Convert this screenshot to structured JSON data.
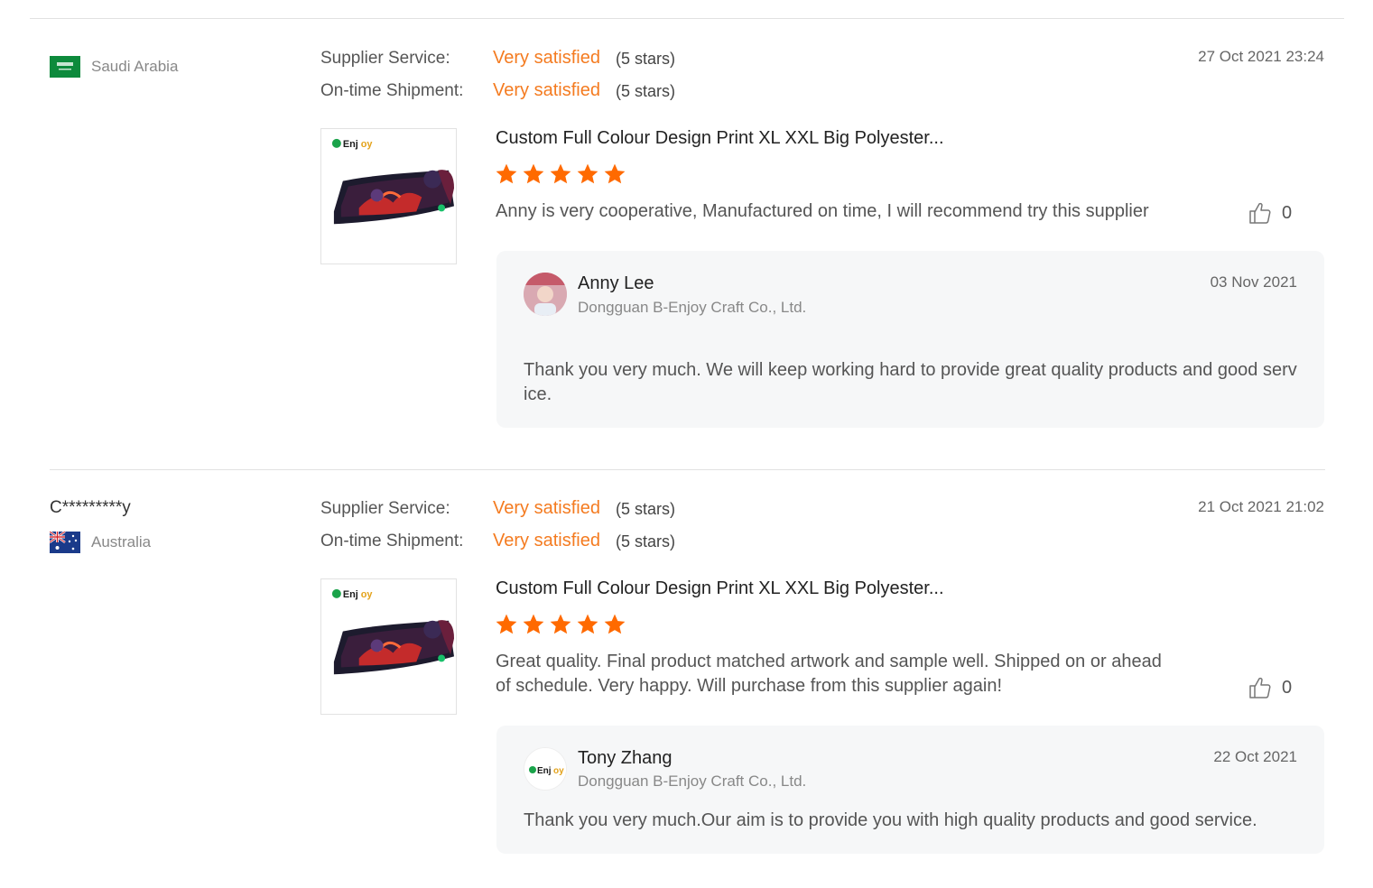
{
  "reviews": [
    {
      "buyer": "",
      "country": "Saudi Arabia",
      "flag_icon": "saudi-arabia-flag",
      "supplier_service_label": "Supplier Service:",
      "supplier_service_rating": "Very satisfied",
      "supplier_service_stars": "(5 stars)",
      "shipment_label": "On-time Shipment:",
      "shipment_rating": "Very satisfied",
      "shipment_stars": "(5 stars)",
      "date": "27 Oct 2021 23:24",
      "product_title": "Custom Full Colour Design Print XL XXL Big Polyester...",
      "star_rating": 5,
      "text": "Anny is very cooperative, Manufactured on time, I will recommend try this supplier",
      "likes": "0",
      "reply": {
        "name": "Anny Lee",
        "company": "Dongguan B-Enjoy Craft Co., Ltd.",
        "date": "03 Nov 2021",
        "text": "Thank you very much. We will keep working hard to provide great quality products and good service."
      }
    },
    {
      "buyer": "C*********y",
      "country": "Australia",
      "flag_icon": "australia-flag",
      "supplier_service_label": "Supplier Service:",
      "supplier_service_rating": "Very satisfied",
      "supplier_service_stars": "(5 stars)",
      "shipment_label": "On-time Shipment:",
      "shipment_rating": "Very satisfied",
      "shipment_stars": "(5 stars)",
      "date": "21 Oct 2021 21:02",
      "product_title": "Custom Full Colour Design Print XL XXL Big Polyester...",
      "star_rating": 5,
      "text": "Great quality. Final product matched artwork and sample well. Shipped on or ahead of schedule. Very happy. Will purchase from this supplier again!",
      "likes": "0",
      "reply": {
        "name": "Tony Zhang",
        "company": "Dongguan B-Enjoy Craft Co., Ltd.",
        "date": "22 Oct 2021",
        "text": "Thank you very much.Our aim is to provide you with high quality products and good service."
      }
    }
  ],
  "colors": {
    "accent": "#f47b20",
    "star": "#ff6a00",
    "reply_bg": "#f6f7f8"
  }
}
